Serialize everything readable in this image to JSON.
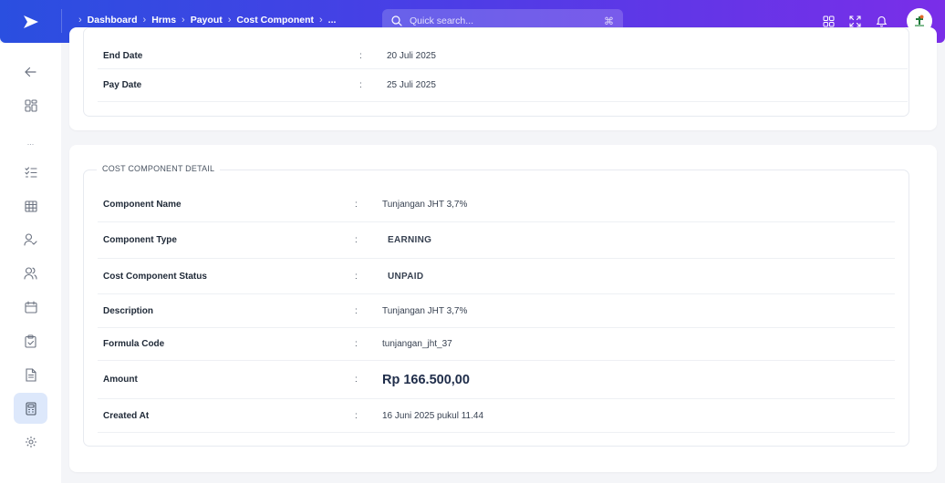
{
  "header": {
    "breadcrumbs": [
      "Dashboard",
      "Hrms",
      "Payout",
      "Cost Component",
      "..."
    ],
    "search": {
      "placeholder": "Quick search...",
      "shortcut": "⌘"
    },
    "colors": {
      "gradient_start": "#2a4fe0",
      "gradient_end": "#7a2ee8"
    }
  },
  "sidebar": {
    "items": [
      {
        "icon": "back-arrow-icon"
      },
      {
        "icon": "dashboard-grid-icon"
      },
      {
        "icon": "more-dots",
        "label": "..."
      },
      {
        "icon": "checklist-icon"
      },
      {
        "icon": "table-icon"
      },
      {
        "icon": "user-check-icon"
      },
      {
        "icon": "users-icon"
      },
      {
        "icon": "calendar-icon"
      },
      {
        "icon": "clipboard-icon"
      },
      {
        "icon": "document-icon"
      },
      {
        "icon": "calculator-icon",
        "active": true
      },
      {
        "icon": "gear-icon"
      }
    ],
    "active_color": "#dde8fb"
  },
  "payout_card": {
    "rows": [
      {
        "label": "End Date",
        "value": "20 Juli 2025"
      },
      {
        "label": "Pay Date",
        "value": "25 Juli 2025"
      }
    ]
  },
  "detail_card": {
    "legend": "COST COMPONENT DETAIL",
    "rows": [
      {
        "label": "Component Name",
        "value": "Tunjangan JHT 3,7%"
      },
      {
        "label": "Component Type",
        "value": "EARNING"
      },
      {
        "label": "Cost Component Status",
        "value": "UNPAID"
      },
      {
        "label": "Description",
        "value": "Tunjangan JHT 3,7%"
      },
      {
        "label": "Formula Code",
        "value": "tunjangan_jht_37"
      },
      {
        "label": "Amount",
        "value": "Rp 166.500,00"
      },
      {
        "label": "Created At",
        "value": "16 Juni 2025 pukul 11.44"
      }
    ],
    "colon": ":",
    "colors": {
      "earning": "#16803c",
      "unpaid": "#1e2a55"
    }
  }
}
